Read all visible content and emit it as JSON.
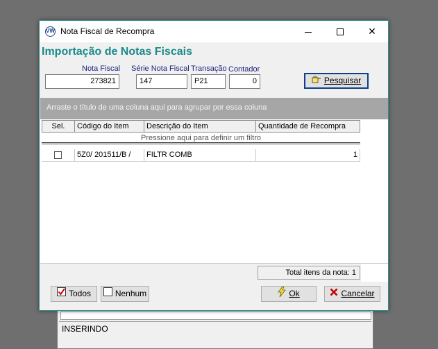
{
  "background": {
    "status_text": "INSERINDO"
  },
  "window": {
    "title": "Nota Fiscal de Recompra",
    "app_icon_text": "VW",
    "minimize_icon": "minimize-icon",
    "maximize_icon": "maximize-icon",
    "close_icon": "close-icon",
    "close_glyph": "✕"
  },
  "form": {
    "heading": "Importação de Notas Fiscais",
    "nota_fiscal_label": "Nota Fiscal",
    "nota_fiscal_value": "273821",
    "serie_label": "Série Nota Fiscal",
    "serie_value": "147",
    "transacao_label": "Transação",
    "transacao_value": "P21",
    "contador_label": "Contador",
    "contador_value": "0",
    "search_button_label": "Pesquisar",
    "search_icon": "hand-pointing-icon"
  },
  "grid": {
    "group_hint": "Arraste o título de uma coluna aqui para agrupar por essa coluna",
    "columns": [
      "Sel.",
      "Código do Item",
      "Descrição do Item",
      "Quantidade de Recompra"
    ],
    "filter_hint": "Pressione aqui para definir um filtro",
    "rows": [
      {
        "selected": false,
        "codigo": "5Z0/  201511/B /",
        "descricao": "FILTR COMB",
        "quantidade": "1"
      }
    ],
    "total_label": "Total itens da nota: 1"
  },
  "buttons": {
    "todos_label": "Todos",
    "nenhum_label": "Nenhum",
    "ok_label": "Ok",
    "cancelar_label": "Cancelar"
  },
  "colors": {
    "accent": "#1b8a8a",
    "label_blue": "#1a237e",
    "group_panel": "#a6a6a6"
  }
}
